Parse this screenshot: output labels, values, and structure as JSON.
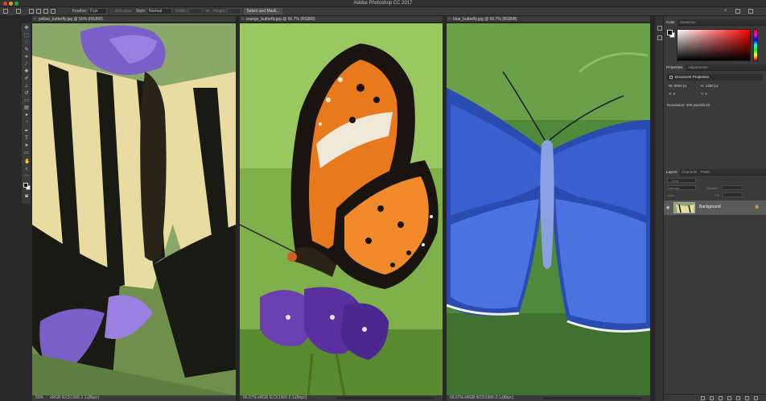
{
  "window": {
    "title": "Adobe Photoshop CC 2017"
  },
  "options_bar": {
    "feather_label": "Feather:",
    "feather_value": "0 px",
    "anti_alias_label": "Anti-alias",
    "style_label": "Style:",
    "style_value": "Normal",
    "width_label": "Width:",
    "height_label": "Height:",
    "select_mask_label": "Select and Mask..."
  },
  "documents": [
    {
      "tab": "yellow_butterfly.jpg @ 50% (RGB/8)",
      "zoom": "50%",
      "profile": "sRGB IEC61966-2.1 (8bpc)"
    },
    {
      "tab": "orange_butterfly.jpg @ 66.7% (RGB/8)",
      "zoom": "66.67%",
      "profile": "sRGB IEC61966-2.1 (8bpc)"
    },
    {
      "tab": "blue_butterfly.jpg @ 66.7% (RGB/8)",
      "zoom": "66.67%",
      "profile": "sRGB IEC61966-2.1 (8bpc)"
    }
  ],
  "color_panel": {
    "tabs": [
      "Color",
      "Swatches"
    ],
    "active": "Color"
  },
  "properties_panel": {
    "tabs": [
      "Properties",
      "Adjustments"
    ],
    "header": "Document Properties",
    "w": "W: 9083 px",
    "h": "H: 3380 px",
    "x": "X: 0",
    "y": "Y: 0",
    "resolution": "Resolution: 300 pixels/inch"
  },
  "layers_panel": {
    "tabs": [
      "Layers",
      "Channels",
      "Paths"
    ],
    "kind_label": "Kind",
    "blend_mode": "Normal",
    "opacity_label": "Opacity:",
    "lock_label": "Lock:",
    "fill_label": "Fill:",
    "layer_name": "Background"
  },
  "colors": {
    "title_bar": "#323232",
    "panel": "#3a3a3a",
    "close_red": "#e0443e",
    "minimize_yellow": "#dea123",
    "zoom_green": "#1aab29",
    "blue_butterfly": "#3a5fd0",
    "orange_butterfly": "#e8791c",
    "yellow_butterfly": "#e8dca0"
  }
}
